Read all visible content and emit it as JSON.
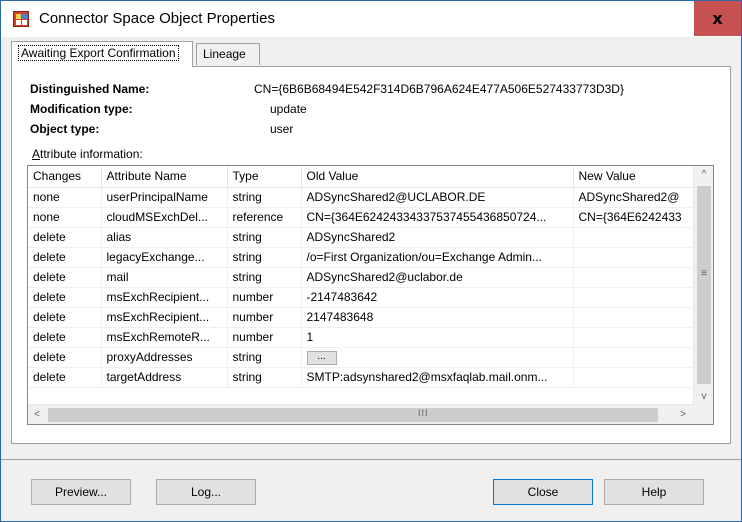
{
  "window": {
    "title": "Connector Space Object Properties",
    "close_glyph": "x"
  },
  "tabs": [
    {
      "label": "Awaiting Export Confirmation"
    },
    {
      "label": "Lineage"
    }
  ],
  "info": {
    "dn_label": "Distinguished Name:",
    "dn_value": "CN={6B6B68494E542F314D6B796A624E477A506E527433773D3D}",
    "modtype_label": "Modification type:",
    "modtype_value": "update",
    "objtype_label": "Object type:",
    "objtype_value": "user"
  },
  "attributes": {
    "label_first": "A",
    "label_rest": "ttribute information:",
    "columns": [
      "Changes",
      "Attribute Name",
      "Type",
      "Old Value",
      "New Value"
    ],
    "rows": [
      {
        "changes": "none",
        "name": "userPrincipalName",
        "type": "string",
        "old": "ADSyncShared2@UCLABOR.DE",
        "new": "ADSyncShared2@"
      },
      {
        "changes": "none",
        "name": "cloudMSExchDel...",
        "type": "reference",
        "old": "CN={364E62424334337537455436850724...",
        "new": "CN={364E6242433"
      },
      {
        "changes": "delete",
        "name": "alias",
        "type": "string",
        "old": "ADSyncShared2",
        "new": ""
      },
      {
        "changes": "delete",
        "name": "legacyExchange...",
        "type": "string",
        "old": "/o=First Organization/ou=Exchange Admin...",
        "new": ""
      },
      {
        "changes": "delete",
        "name": "mail",
        "type": "string",
        "old": "ADSyncShared2@uclabor.de",
        "new": ""
      },
      {
        "changes": "delete",
        "name": "msExchRecipient...",
        "type": "number",
        "old": "-2147483642",
        "new": ""
      },
      {
        "changes": "delete",
        "name": "msExchRecipient...",
        "type": "number",
        "old": "2147483648",
        "new": ""
      },
      {
        "changes": "delete",
        "name": "msExchRemoteR...",
        "type": "number",
        "old": "1",
        "new": ""
      },
      {
        "changes": "delete",
        "name": "proxyAddresses",
        "type": "string",
        "old": "",
        "old_button": "...",
        "new": ""
      },
      {
        "changes": "delete",
        "name": "targetAddress",
        "type": "string",
        "old": "SMTP:adsynshared2@msxfaqlab.mail.onm...",
        "new": ""
      }
    ]
  },
  "scrollbars": {
    "up": "^",
    "down": "v",
    "left": "<",
    "right": ">",
    "grip_h": "III",
    "grip_v": "≡"
  },
  "buttons": {
    "preview": "Preview...",
    "log": "Log...",
    "close": "Close",
    "help": "Help"
  }
}
